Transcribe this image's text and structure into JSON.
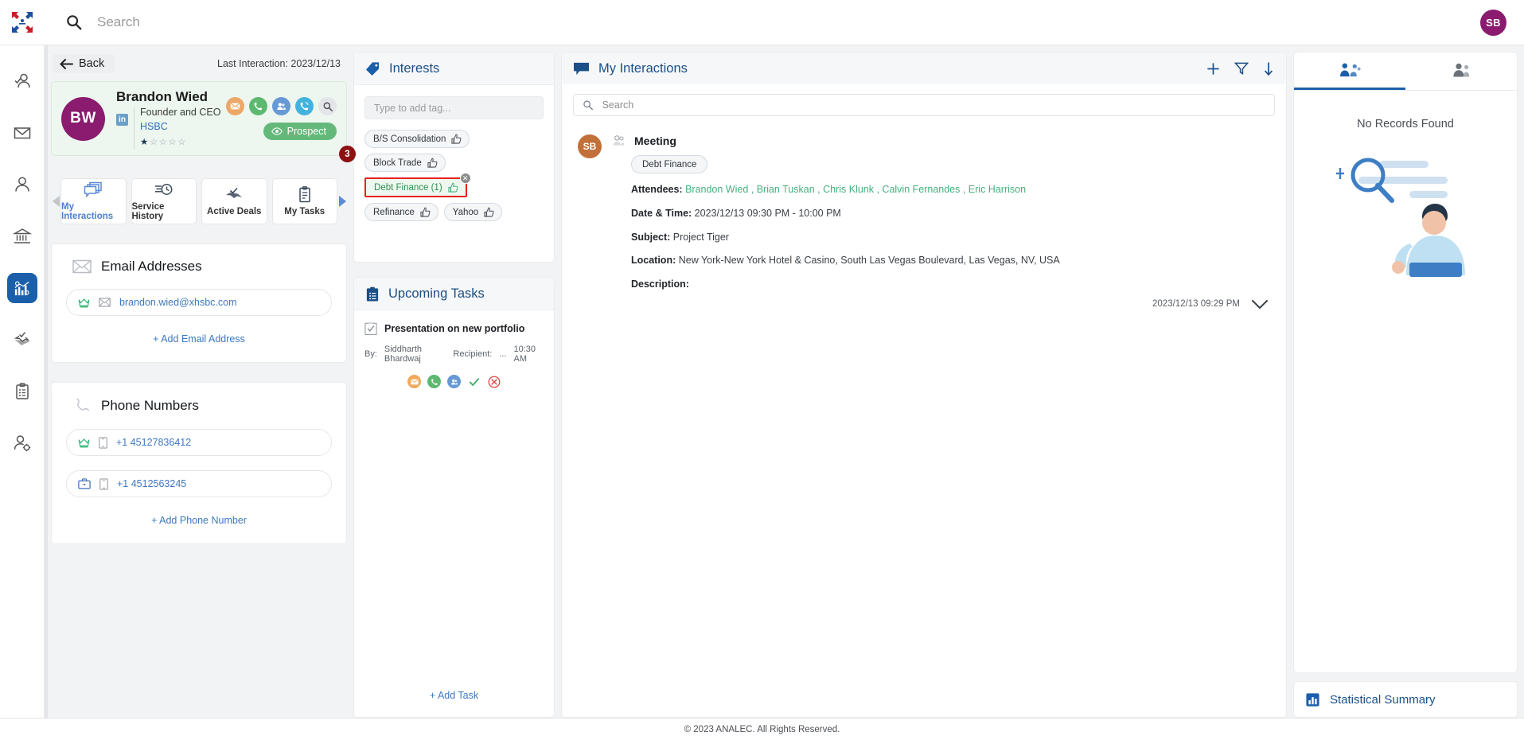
{
  "colors": {
    "brand_blue": "#1b5fab",
    "accent_link": "#3d78c0",
    "prospect_green": "#64b97a",
    "avatar_purple": "#8a1b6e",
    "avatar_orange": "#c2703a",
    "badge_dark_red": "#8c1212",
    "highlight_red": "#e8221a",
    "attendee_green": "#45b07c",
    "header_title_blue": "#1b4f86"
  },
  "topbar": {
    "logo_icon": "analec-logo-icon",
    "search_icon": "search-icon",
    "search_placeholder": "Search",
    "search_value": "",
    "user_initials": "SB"
  },
  "rail": {
    "items": [
      {
        "icon": "user-check-icon",
        "active": false
      },
      {
        "icon": "envelope-icon",
        "active": false
      },
      {
        "icon": "person-icon",
        "active": false
      },
      {
        "icon": "bank-icon",
        "active": false
      },
      {
        "icon": "analytics-chart-icon",
        "active": true
      },
      {
        "icon": "handshake-check-icon",
        "active": false
      },
      {
        "icon": "clipboard-list-icon",
        "active": false
      },
      {
        "icon": "user-settings-icon",
        "active": false
      }
    ]
  },
  "contact": {
    "back_label": "Back",
    "back_icon": "arrow-left-icon",
    "last_interaction": "Last Interaction: 2023/12/13",
    "avatar_initials": "BW",
    "name": "Brandon Wied",
    "linkedin_badge": "in",
    "role": "Founder and CEO",
    "organization": "HSBC",
    "rating": 1,
    "rating_max": 5,
    "actions": [
      {
        "icon": "email-icon",
        "name": "send-email"
      },
      {
        "icon": "phone-icon",
        "name": "call"
      },
      {
        "icon": "meeting-icon",
        "name": "schedule-meeting"
      },
      {
        "icon": "phone-callback-icon",
        "name": "log-call"
      },
      {
        "icon": "search-icon",
        "name": "search-contact"
      }
    ],
    "status_label": "Prospect",
    "status_icon": "eye-icon"
  },
  "tabs": {
    "left_arrow_icon": "chevron-left-icon",
    "right_arrow_icon": "chevron-right-icon",
    "items": [
      {
        "label": "My Interactions",
        "icon": "interactions-stack-icon",
        "active": true
      },
      {
        "label": "Service History",
        "icon": "history-clock-icon",
        "active": false
      },
      {
        "label": "Active Deals",
        "icon": "handshake-check-icon",
        "active": false
      },
      {
        "label": "My Tasks",
        "icon": "clipboard-icon",
        "active": false
      }
    ]
  },
  "email_section": {
    "icon": "envelope-icon",
    "title": "Email Addresses",
    "rows": [
      {
        "type_icon": "crown-icon",
        "kind_icon": "envelope-icon",
        "value": "brandon.wied@xhsbc.com"
      }
    ],
    "add_label": "+ Add Email Address"
  },
  "phone_section": {
    "icon": "phone-icon",
    "title": "Phone Numbers",
    "rows": [
      {
        "type_icon": "crown-icon",
        "kind_icon": "mobile-icon",
        "value": "+1 45127836412"
      },
      {
        "type_icon": "briefcase-icon",
        "kind_icon": "mobile-icon",
        "value": "+1 4512563245"
      }
    ],
    "add_label": "+ Add Phone Number"
  },
  "interests": {
    "icon": "tag-icon",
    "title": "Interests",
    "tag_input_placeholder": "Type to add tag...",
    "tag_input_value": "",
    "count_badge": "3",
    "tags": [
      {
        "label": "B/S Consolidation",
        "thumb_icon": "thumbs-up-icon",
        "selected": false
      },
      {
        "label": "Block Trade",
        "thumb_icon": "thumbs-up-icon",
        "selected": false
      },
      {
        "label": "Debt Finance (1)",
        "thumb_icon": "thumbs-up-icon",
        "selected": true,
        "remove_icon": "close-circle-icon"
      },
      {
        "label": "Refinance",
        "thumb_icon": "thumbs-up-icon",
        "selected": false
      },
      {
        "label": "Yahoo",
        "thumb_icon": "thumbs-up-icon",
        "selected": false
      }
    ]
  },
  "tasks": {
    "icon": "clipboard-list-icon",
    "title": "Upcoming Tasks",
    "items": [
      {
        "check_icon": "task-check-icon",
        "title": "Presentation on new portfolio",
        "by_label": "By:",
        "by_value": "Siddharth Bhardwaj",
        "recipient_label": "Recipient:",
        "recipient_value": "...",
        "time": "10:30 AM",
        "actions": [
          {
            "icon": "email-icon",
            "name": "task-email"
          },
          {
            "icon": "phone-icon",
            "name": "task-call"
          },
          {
            "icon": "meeting-icon",
            "name": "task-meeting"
          },
          {
            "icon": "check-icon",
            "name": "task-complete"
          },
          {
            "icon": "close-icon",
            "name": "task-cancel"
          }
        ]
      }
    ],
    "add_label": "+ Add Task"
  },
  "interactions": {
    "icon": "chat-icon",
    "title": "My Interactions",
    "header_actions": [
      {
        "icon": "plus-icon",
        "name": "add-interaction"
      },
      {
        "icon": "filter-icon",
        "name": "filter-interactions"
      },
      {
        "icon": "sort-icon",
        "name": "sort-interactions"
      }
    ],
    "search_icon": "search-icon",
    "search_placeholder": "Search",
    "search_value": "",
    "items": [
      {
        "avatar_initials": "SB",
        "type_icon": "meeting-icon",
        "type": "Meeting",
        "tag": "Debt Finance",
        "attendees_label": "Attendees:",
        "attendees": [
          "Brandon Wied",
          "Brian Tuskan",
          "Chris Klunk",
          "Calvin Fernandes",
          "Eric Harrison"
        ],
        "datetime_label": "Date & Time:",
        "datetime_value": "2023/12/13 09:30 PM - 10:00 PM",
        "subject_label": "Subject:",
        "subject_value": "Project Tiger",
        "location_label": "Location:",
        "location_value": "New York-New York Hotel & Casino, South Las Vegas Boulevard, Las Vegas, NV, USA",
        "description_label": "Description:",
        "description_value": "",
        "timestamp": "2023/12/13 09:29 PM",
        "expand_icon": "chevron-down-icon"
      }
    ]
  },
  "right_panel": {
    "tabs": [
      {
        "icon": "org-chart-icon",
        "name": "relationship-tab",
        "active": true
      },
      {
        "icon": "contacts-icon",
        "name": "contacts-tab",
        "active": false
      }
    ],
    "no_records_text": "No Records Found",
    "empty_illustration": "person-search-illustration",
    "statistical_summary": {
      "icon": "bar-chart-icon",
      "label": "Statistical Summary"
    }
  },
  "footer": {
    "copyright": "© 2023 ANALEC. All Rights Reserved."
  }
}
